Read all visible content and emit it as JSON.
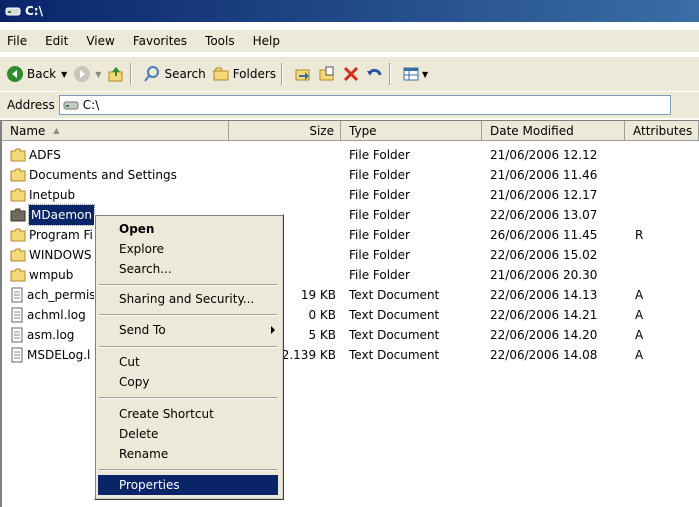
{
  "window": {
    "title": "C:\\"
  },
  "menu": [
    "File",
    "Edit",
    "View",
    "Favorites",
    "Tools",
    "Help"
  ],
  "toolbar": {
    "back": "Back",
    "search": "Search",
    "folders": "Folders"
  },
  "address": {
    "label": "Address",
    "value": "C:\\"
  },
  "columns": {
    "name": "Name",
    "size": "Size",
    "type": "Type",
    "date": "Date Modified",
    "attributes": "Attributes"
  },
  "files": [
    {
      "name": "ADFS",
      "size": "",
      "type": "File Folder",
      "date": "21/06/2006 12.12",
      "attr": "",
      "icon": "folder-icon"
    },
    {
      "name": "Documents and Settings",
      "size": "",
      "type": "File Folder",
      "date": "21/06/2006 11.46",
      "attr": "",
      "icon": "folder-icon"
    },
    {
      "name": "Inetpub",
      "size": "",
      "type": "File Folder",
      "date": "21/06/2006 12.17",
      "attr": "",
      "icon": "folder-icon"
    },
    {
      "name": "MDaemon",
      "size": "",
      "type": "File Folder",
      "date": "22/06/2006 13.07",
      "attr": "",
      "icon": "folder-icon"
    },
    {
      "name": "Program Fi",
      "size": "",
      "type": "File Folder",
      "date": "26/06/2006 11.45",
      "attr": "R",
      "icon": "folder-icon"
    },
    {
      "name": "WINDOWS",
      "size": "",
      "type": "File Folder",
      "date": "22/06/2006 15.02",
      "attr": "",
      "icon": "folder-icon"
    },
    {
      "name": "wmpub",
      "size": "",
      "type": "File Folder",
      "date": "21/06/2006 20.30",
      "attr": "",
      "icon": "folder-icon"
    },
    {
      "name": "ach_permis",
      "size": "19 KB",
      "type": "Text Document",
      "date": "22/06/2006 14.13",
      "attr": "A",
      "icon": "text-file-icon"
    },
    {
      "name": "achml.log",
      "size": "0 KB",
      "type": "Text Document",
      "date": "22/06/2006 14.21",
      "attr": "A",
      "icon": "text-file-icon"
    },
    {
      "name": "asm.log",
      "size": "5 KB",
      "type": "Text Document",
      "date": "22/06/2006 14.20",
      "attr": "A",
      "icon": "text-file-icon"
    },
    {
      "name": "MSDELog.l",
      "size": "2.139 KB",
      "type": "Text Document",
      "date": "22/06/2006 14.08",
      "attr": "A",
      "icon": "text-file-icon"
    }
  ],
  "context_menu": {
    "open": "Open",
    "explore": "Explore",
    "search": "Search...",
    "sharing": "Sharing and Security...",
    "send_to": "Send To",
    "cut": "Cut",
    "copy": "Copy",
    "create_shortcut": "Create Shortcut",
    "delete": "Delete",
    "rename": "Rename",
    "properties": "Properties"
  },
  "colors": {
    "title_start": "#0a246a",
    "title_end": "#3a6ea5",
    "chrome": "#ece9d8",
    "selection": "#0a246a",
    "folder": "#f5d879"
  }
}
